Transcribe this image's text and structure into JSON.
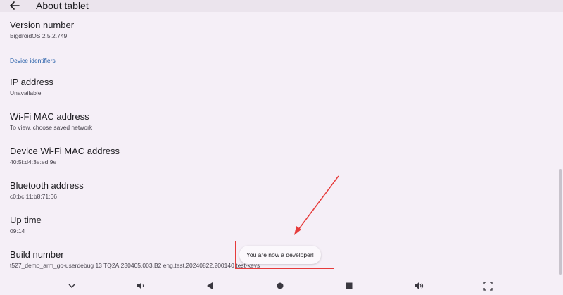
{
  "appbar": {
    "title": "About tablet"
  },
  "items": {
    "version": {
      "title": "Version number",
      "value": "BigdroidOS 2.5.2.749"
    },
    "section": "Device identifiers",
    "ip": {
      "title": "IP address",
      "value": "Unavailable"
    },
    "wifi_mac": {
      "title": "Wi-Fi MAC address",
      "value": "To view, choose saved network"
    },
    "device_wifi_mac": {
      "title": "Device Wi-Fi MAC address",
      "value": "40:5f:d4:3e:ed:9e"
    },
    "bluetooth": {
      "title": "Bluetooth address",
      "value": "c0:bc:11:b8:71:66"
    },
    "uptime": {
      "title": "Up time",
      "value": "09:14"
    },
    "build": {
      "title": "Build number",
      "value": "t527_demo_arm_go-userdebug 13 TQ2A.230405.003.B2 eng.test.20240822.200140 test-keys"
    }
  },
  "toast": {
    "text": "You are now a developer!"
  },
  "colors": {
    "annotation": "#e63b3b",
    "accent": "#1f5aa6",
    "background": "#f5eff7"
  },
  "navbar_icons": [
    "chevron-down-icon",
    "volume-down-icon",
    "back-triangle-icon",
    "home-circle-icon",
    "recents-square-icon",
    "volume-up-icon",
    "screenshot-icon"
  ]
}
